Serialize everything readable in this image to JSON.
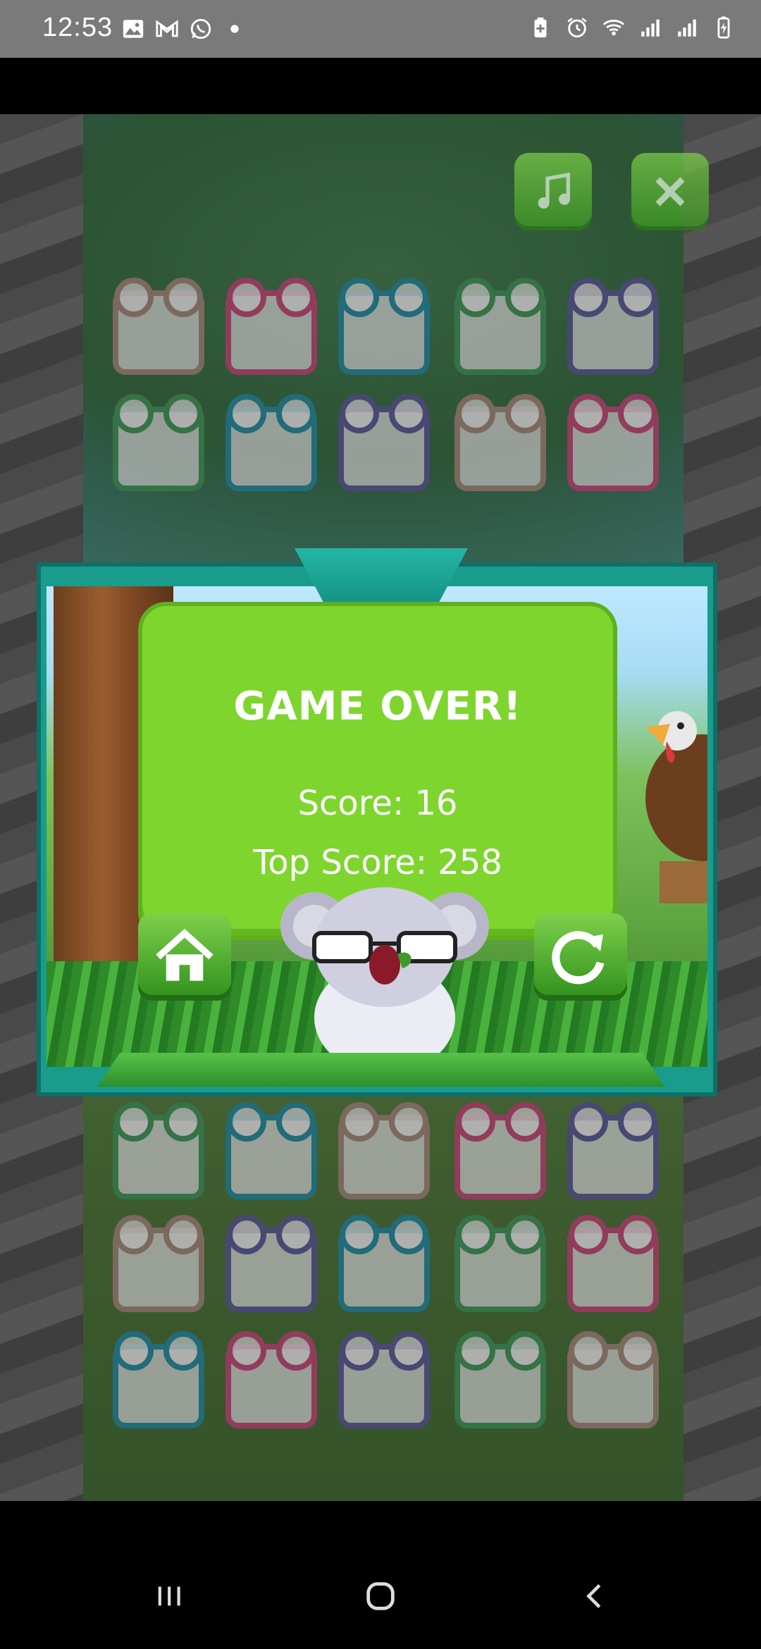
{
  "status_bar": {
    "time": "12:53",
    "left_icons": [
      "image-icon",
      "gmail-icon",
      "whatsapp-icon",
      "dot-icon"
    ],
    "right_icons": [
      "battery-saver-icon",
      "alarm-icon",
      "wifi-icon",
      "signal-icon",
      "signal-icon-2",
      "battery-icon"
    ]
  },
  "game": {
    "top_buttons": [
      {
        "name": "music",
        "icon": "music-note-icon"
      },
      {
        "name": "close",
        "icon": "close-icon"
      }
    ]
  },
  "dialog": {
    "title": "GAME OVER!",
    "score_text": "Score: 16",
    "top_score_text": "Top Score: 258",
    "home_button_icon": "home-icon",
    "restart_button_icon": "restart-icon"
  },
  "nav": {
    "recents_icon": "recents-icon",
    "home_icon": "home-circle-icon",
    "back_icon": "back-icon"
  },
  "colors": {
    "panel_green": "#7ed52e",
    "dialog_teal": "#1a9c8d",
    "button_green": "#4fb02f"
  }
}
